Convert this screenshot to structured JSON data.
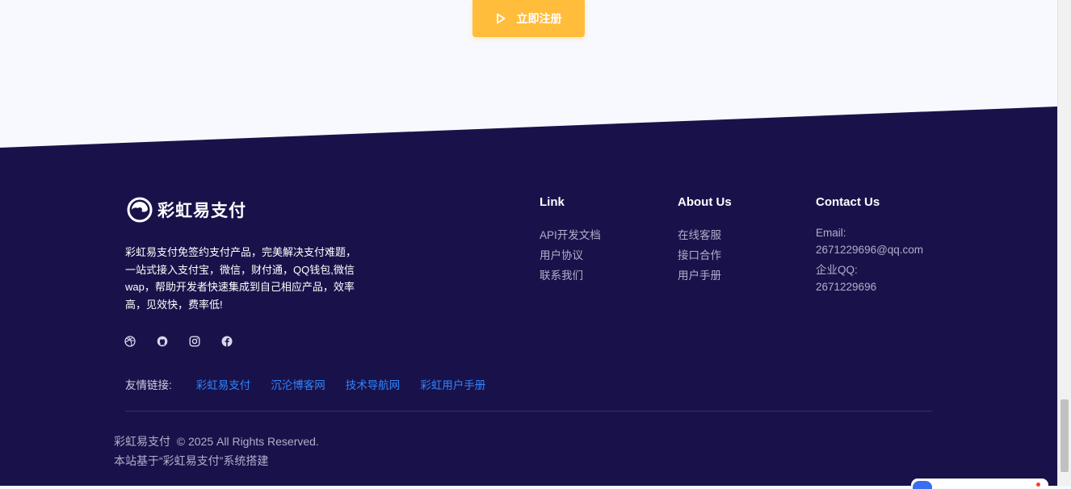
{
  "cta": {
    "label": "立即注册",
    "icon": "play-icon",
    "color": "#ffbd3b"
  },
  "footer": {
    "background": "#19124a",
    "brand": {
      "name": "彩虹易支付",
      "icon": "swirl-logo-icon"
    },
    "description": "彩虹易支付免签约支付产品，完美解决支付难题，一站式接入支付宝，微信，财付通，QQ钱包,微信wap，帮助开发者快速集成到自己相应产品，效率高，见效快，费率低!",
    "social": [
      "dribbble-icon",
      "github-icon",
      "instagram-icon",
      "facebook-icon"
    ],
    "friends": {
      "label": "友情链接:",
      "links": [
        "彩虹易支付",
        "沉沦博客网",
        "技术导航网",
        "彩虹用户手册"
      ],
      "link_color": "#2f84ff"
    },
    "columns": {
      "link": {
        "title": "Link",
        "items": [
          "API开发文档",
          "用户协议",
          "联系我们"
        ]
      },
      "about": {
        "title": "About Us",
        "items": [
          "在线客服",
          "接口合作",
          "用户手册"
        ]
      },
      "contact": {
        "title": "Contact Us",
        "email_label": "Email:",
        "email": "2671229696@qq.com",
        "qq_label": "企业QQ:",
        "qq": "2671229696"
      }
    },
    "copyright": "彩虹易支付  © 2025 All Rights Reserved.",
    "built_on": "本站基于“彩虹易支付”系统搭建"
  }
}
